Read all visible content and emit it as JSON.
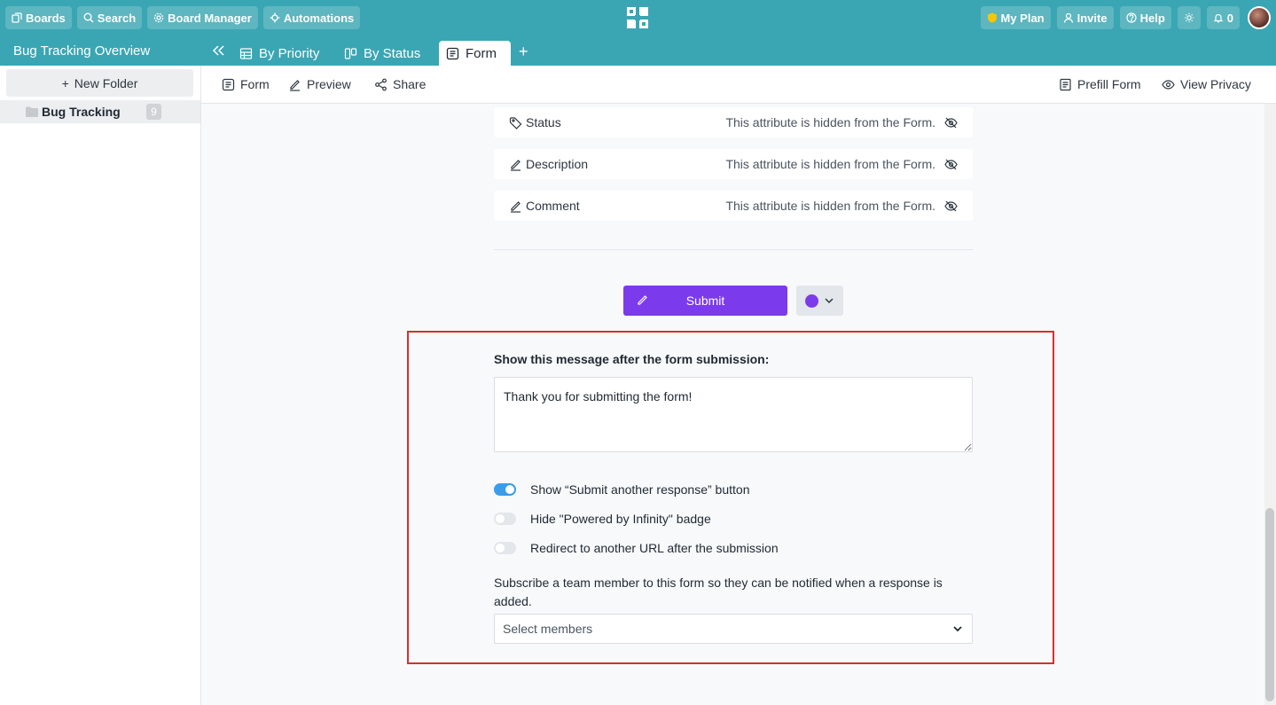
{
  "topbar": {
    "boards": "Boards",
    "search": "Search",
    "board_manager": "Board Manager",
    "automations": "Automations",
    "my_plan": "My Plan",
    "invite": "Invite",
    "help": "Help",
    "notifications_count": "0"
  },
  "board": {
    "title": "Bug Tracking Overview",
    "tabs": [
      {
        "label": "By Priority",
        "icon": "table-icon"
      },
      {
        "label": "By Status",
        "icon": "columns-icon"
      },
      {
        "label": "Form",
        "icon": "form-icon",
        "active": true
      }
    ],
    "add_tab": "+"
  },
  "sidebar": {
    "new_folder": "New Folder",
    "folders": [
      {
        "label": "Bug Tracking",
        "count": "9"
      }
    ]
  },
  "toolbar": {
    "form": "Form",
    "preview": "Preview",
    "share": "Share",
    "prefill": "Prefill Form",
    "view_privacy": "View Privacy"
  },
  "form": {
    "attributes": [
      {
        "name": "Status",
        "icon": "tag-icon",
        "hidden_text": "This attribute is hidden from the Form."
      },
      {
        "name": "Description",
        "icon": "pen-icon",
        "hidden_text": "This attribute is hidden from the Form."
      },
      {
        "name": "Comment",
        "icon": "pen-icon",
        "hidden_text": "This attribute is hidden from the Form."
      }
    ],
    "submit_label": "Submit",
    "submit_color": "#7c3aed",
    "message_label": "Show this message after the form submission:",
    "message_value": "Thank you for submitting the form!",
    "toggles": [
      {
        "label": "Show “Submit another response” button",
        "on": true
      },
      {
        "label": "Hide \"Powered by Infinity\" badge",
        "on": false
      },
      {
        "label": "Redirect to another URL after the submission",
        "on": false
      }
    ],
    "subscribe_text": "Subscribe a team member to this form so they can be notified when a response is added.",
    "select_placeholder": "Select members"
  },
  "colors": {
    "brand": "#3aa6b3",
    "accent": "#7c3aed",
    "highlight": "#d62f2f",
    "toggle_on": "#3b9ce8"
  }
}
